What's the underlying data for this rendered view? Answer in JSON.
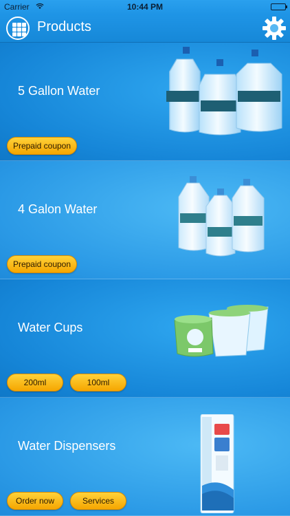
{
  "status_bar": {
    "carrier": "Carrier",
    "time": "10:44 PM"
  },
  "navbar": {
    "title": "Products"
  },
  "products": [
    {
      "title": "5 Gallon Water",
      "buttons": [
        "Prepaid coupon"
      ]
    },
    {
      "title": "4 Galon Water",
      "buttons": [
        "Prepaid coupon"
      ]
    },
    {
      "title": "Water Cups",
      "buttons": [
        "200ml",
        "100ml"
      ]
    },
    {
      "title": "Water Dispensers",
      "buttons": [
        "Order now",
        "Services"
      ]
    }
  ],
  "colors": {
    "accent": "#1686d8",
    "button": "#f5a600"
  },
  "icons": {
    "menu": "grid-icon",
    "settings": "gear-icon"
  }
}
